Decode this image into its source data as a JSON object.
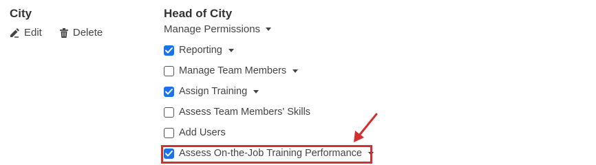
{
  "left": {
    "title": "City",
    "edit_label": "Edit",
    "delete_label": "Delete"
  },
  "right": {
    "title": "Head of City",
    "manage_permissions_label": "Manage Permissions",
    "permissions": [
      {
        "label": "Reporting",
        "checked": true,
        "has_dropdown": true
      },
      {
        "label": "Manage Team Members",
        "checked": false,
        "has_dropdown": true
      },
      {
        "label": "Assign Training",
        "checked": true,
        "has_dropdown": true
      },
      {
        "label": "Assess Team Members' Skills",
        "checked": false,
        "has_dropdown": false
      },
      {
        "label": "Add Users",
        "checked": false,
        "has_dropdown": false
      },
      {
        "label": "Assess On-the-Job Training Performance",
        "checked": true,
        "has_dropdown": true
      }
    ]
  },
  "annotation": {
    "highlight_color": "#d32f2f",
    "arrow_color": "#d32f2f",
    "target": "Assess On-the-Job Training Performance"
  },
  "colors": {
    "checkbox_checked": "#1a73e8",
    "text": "#444444",
    "title": "#333333"
  }
}
